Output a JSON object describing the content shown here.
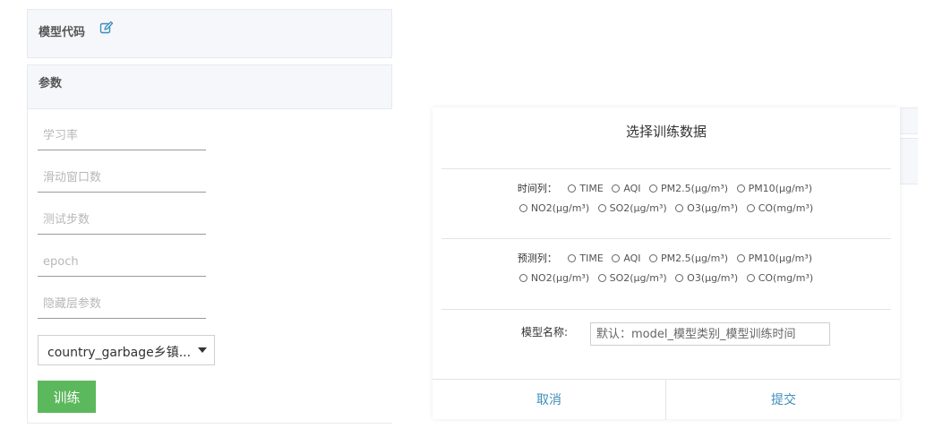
{
  "model_code": {
    "title": "模型代码",
    "edit_icon": "edit-icon"
  },
  "params": {
    "title": "参数",
    "fields": [
      {
        "placeholder": "学习率"
      },
      {
        "placeholder": "滑动窗口数"
      },
      {
        "placeholder": "测试步数"
      },
      {
        "placeholder": "epoch"
      },
      {
        "placeholder": "隐藏层参数"
      }
    ],
    "dataset_select": "country_garbage乡镇...",
    "train_button": "训练"
  },
  "dialog": {
    "title": "选择训练数据",
    "time_col": {
      "label": "时间列：",
      "options": [
        "TIME",
        "AQI",
        "PM2.5(μg/m³)",
        "PM10(μg/m³)",
        "NO2(μg/m³)",
        "SO2(μg/m³)",
        "O3(μg/m³)",
        "CO(mg/m³)"
      ]
    },
    "predict_col": {
      "label": "预测列：",
      "options": [
        "TIME",
        "AQI",
        "PM2.5(μg/m³)",
        "PM10(μg/m³)",
        "NO2(μg/m³)",
        "SO2(μg/m³)",
        "O3(μg/m³)",
        "CO(mg/m³)"
      ]
    },
    "model_name": {
      "label": "模型名称:",
      "placeholder": "默认：model_模型类别_模型训练时间"
    },
    "cancel": "取消",
    "submit": "提交"
  },
  "colors": {
    "accent": "#3c8dbc",
    "train_button": "#5cb85c"
  }
}
